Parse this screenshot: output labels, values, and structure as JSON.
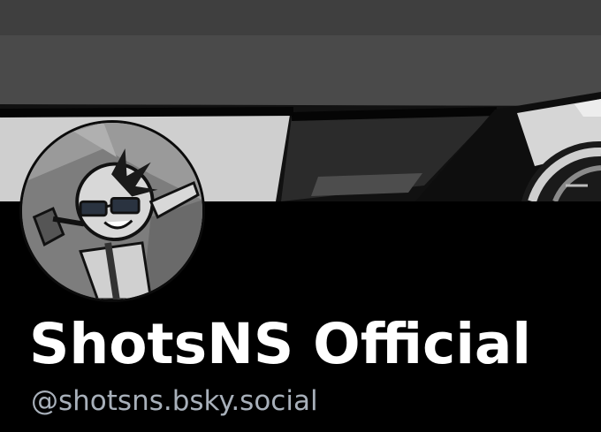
{
  "profile": {
    "display_name": "ShotsNS Official",
    "handle": "@shotsns.bsky.social"
  },
  "images": {
    "banner": "grayscale cartoon vehicle banner",
    "avatar": "grayscale cartoon character with sunglasses"
  },
  "colors": {
    "background": "#000000",
    "name_text": "#ffffff",
    "handle_text": "#a8b0ba",
    "banner_dark": "#4a4a4a",
    "banner_light": "#c9c9c9"
  }
}
